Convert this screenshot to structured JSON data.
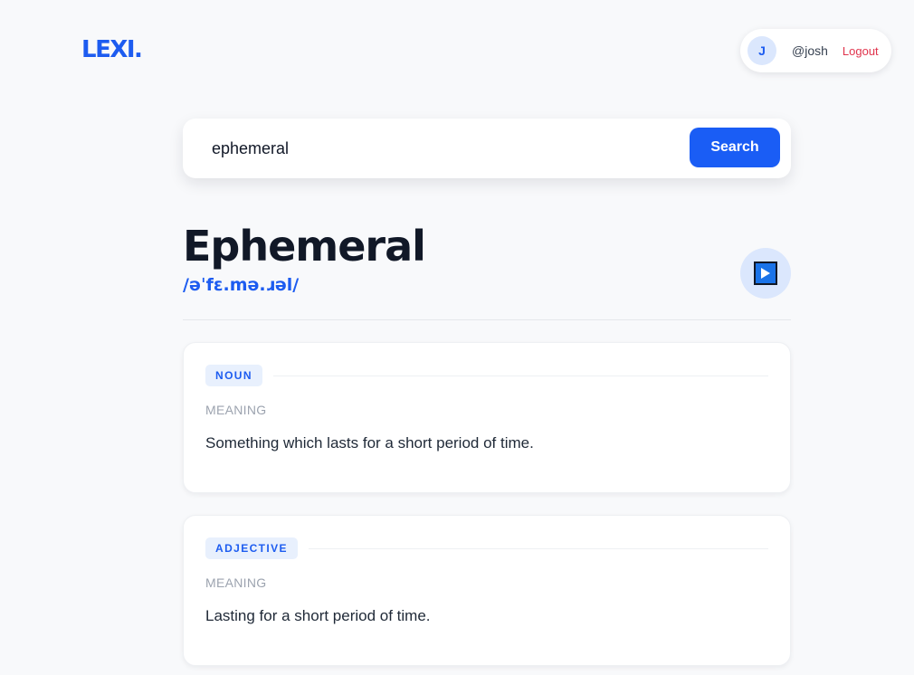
{
  "app": {
    "logo": "LEXI."
  },
  "user": {
    "avatar_initial": "J",
    "handle": "@josh",
    "logout_label": "Logout"
  },
  "search": {
    "value": "ephemeral",
    "button_label": "Search"
  },
  "entry": {
    "word": "Ephemeral",
    "phonetic": "/əˈfɛ.mə.ɹəl/",
    "audio_icon": "play-icon",
    "meanings": [
      {
        "part_of_speech": "NOUN",
        "label": "MEANING",
        "definition": "Something which lasts for a short period of time."
      },
      {
        "part_of_speech": "ADJECTIVE",
        "label": "MEANING",
        "definition": "Lasting for a short period of time."
      }
    ]
  },
  "colors": {
    "accent": "#1d5cf0",
    "logout": "#e0334c",
    "background": "#f8f9fb"
  }
}
